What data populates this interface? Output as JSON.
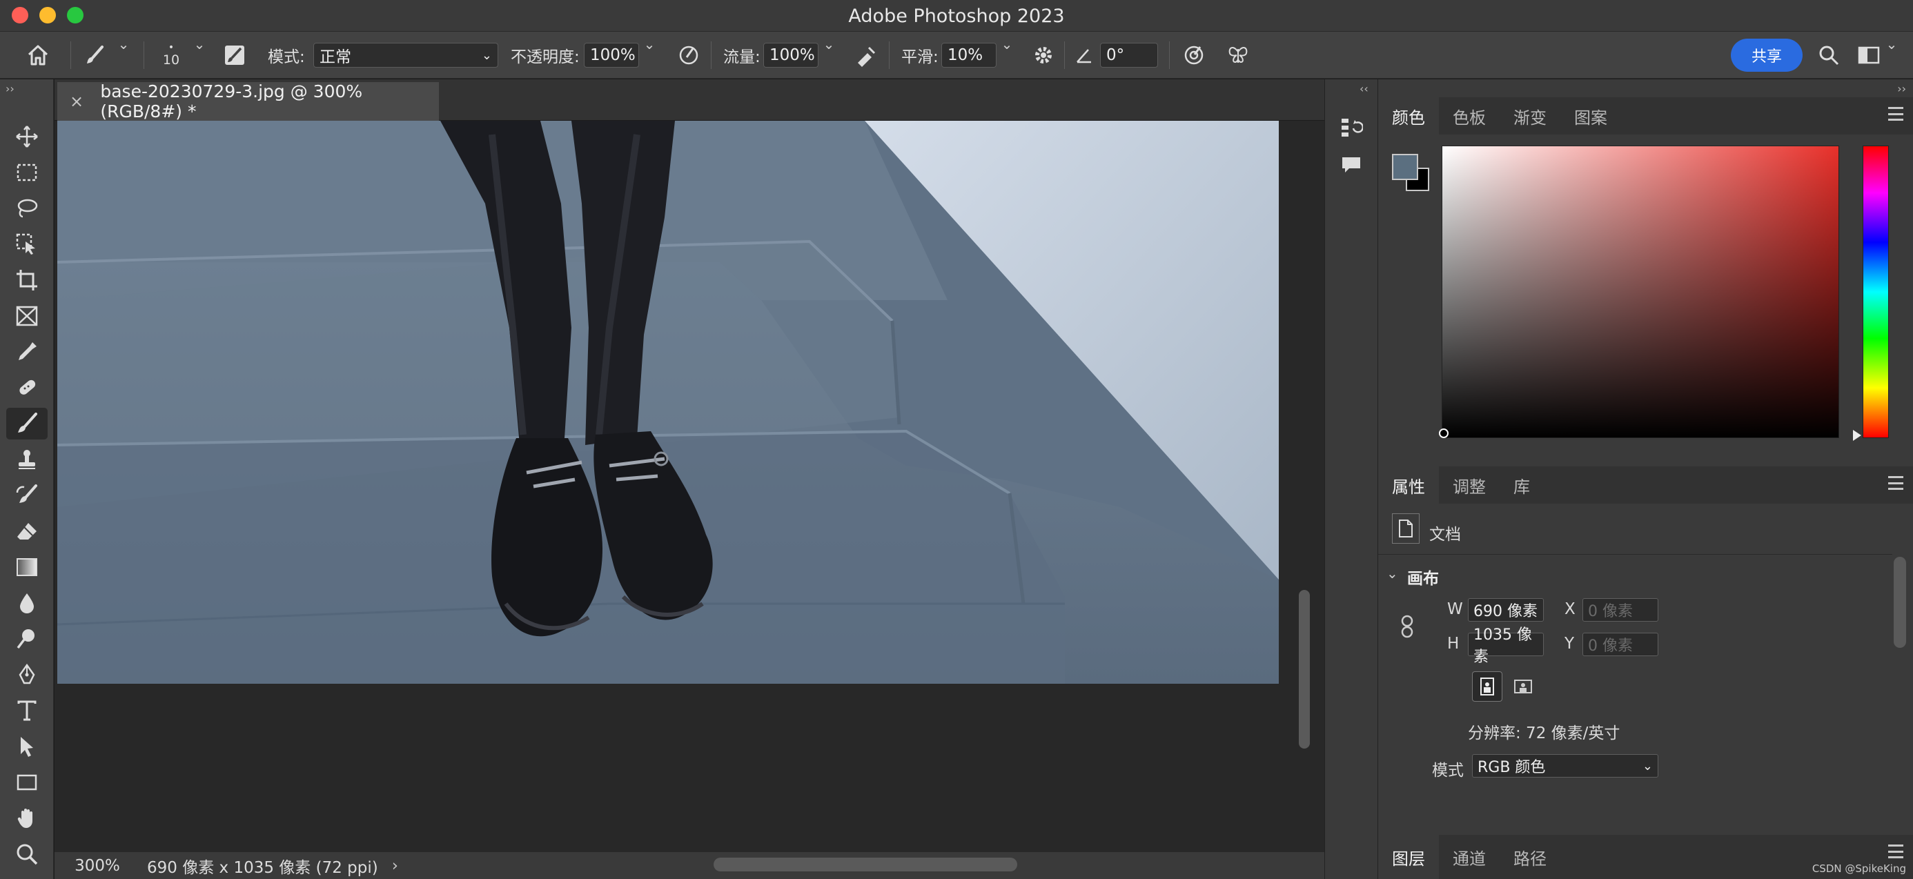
{
  "window": {
    "title": "Adobe Photoshop 2023"
  },
  "options_bar": {
    "brush_size": "10",
    "mode_label": "模式:",
    "mode_value": "正常",
    "opacity_label": "不透明度:",
    "opacity_value": "100%",
    "flow_label": "流量:",
    "flow_value": "100%",
    "smoothing_label": "平滑:",
    "smoothing_value": "10%",
    "angle_value": "0°",
    "share_label": "共享"
  },
  "toolbar": {
    "tools": [
      "move-icon",
      "marquee-icon",
      "lasso-icon",
      "object-select-icon",
      "crop-icon",
      "frame-icon",
      "eyedropper-icon",
      "healing-brush-icon",
      "brush-icon",
      "clone-stamp-icon",
      "history-brush-icon",
      "eraser-icon",
      "gradient-icon",
      "blur-icon",
      "dodge-icon",
      "pen-icon",
      "type-icon",
      "path-select-icon",
      "rectangle-icon",
      "hand-icon",
      "zoom-icon"
    ],
    "active_tool": "brush-icon"
  },
  "document": {
    "tab_title": "base-20230729-3.jpg @ 300%(RGB/8#) *",
    "zoom": "300%",
    "info": "690 像素 x 1035 像素 (72 ppi)"
  },
  "color_panel": {
    "tabs": [
      "颜色",
      "色板",
      "渐变",
      "图案"
    ],
    "foreground_color": "#5b6f80",
    "background_color": "#000000",
    "hue_color": "#e8302a"
  },
  "properties_panel": {
    "tabs": [
      "属性",
      "调整",
      "库"
    ],
    "doc_label": "文档",
    "canvas_section": "画布",
    "w_label": "W",
    "w_value": "690 像素",
    "h_label": "H",
    "h_value": "1035 像素",
    "x_label": "X",
    "x_placeholder": "0 像素",
    "y_label": "Y",
    "y_placeholder": "0 像素",
    "resolution": "分辨率: 72 像素/英寸",
    "mode_label": "模式",
    "mode_value": "RGB 颜色"
  },
  "layers_panel": {
    "tabs": [
      "图层",
      "通道",
      "路径"
    ]
  },
  "watermark": "CSDN @SpikeKing"
}
